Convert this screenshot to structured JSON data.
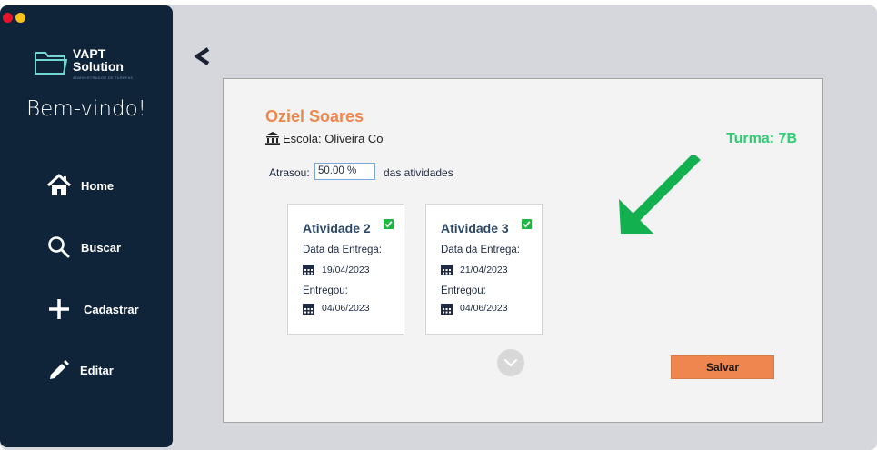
{
  "app": {
    "logo": {
      "line1": "VAPT",
      "line2": "Solution",
      "tagline": "ADMINISTRADOR DE TAREFAS"
    },
    "welcome": "Bem-vindo!"
  },
  "sidebar": {
    "items": [
      {
        "label": "Home",
        "icon": "home-icon"
      },
      {
        "label": "Buscar",
        "icon": "search-icon"
      },
      {
        "label": "Cadastrar",
        "icon": "plus-icon"
      },
      {
        "label": "Editar",
        "icon": "pencil-icon"
      }
    ]
  },
  "student": {
    "name": "Oziel Soares",
    "school": "Escola: Oliveira Co",
    "turma": "Turma: 7B"
  },
  "late": {
    "label": "Atrasou:",
    "value": "50.00 %",
    "suffix": "das atividades"
  },
  "activities": [
    {
      "title": "Atividade 2",
      "delivery_label": "Data da Entrega:",
      "delivery_date": "19/04/2023",
      "delivered_label": "Entregou:",
      "delivered_date": "04/06/2023",
      "done": true
    },
    {
      "title": "Atividade 3",
      "delivery_label": "Data da Entrega:",
      "delivery_date": "21/04/2023",
      "delivered_label": "Entregou:",
      "delivered_date": "04/06/2023",
      "done": true
    }
  ],
  "actions": {
    "save_label": "Salvar"
  },
  "colors": {
    "sidebar_bg": "#0f2339",
    "accent_orange": "#f0874f",
    "turma_green": "#2fcc71",
    "check_green": "#21b545",
    "arrow_green": "#13b04f"
  }
}
